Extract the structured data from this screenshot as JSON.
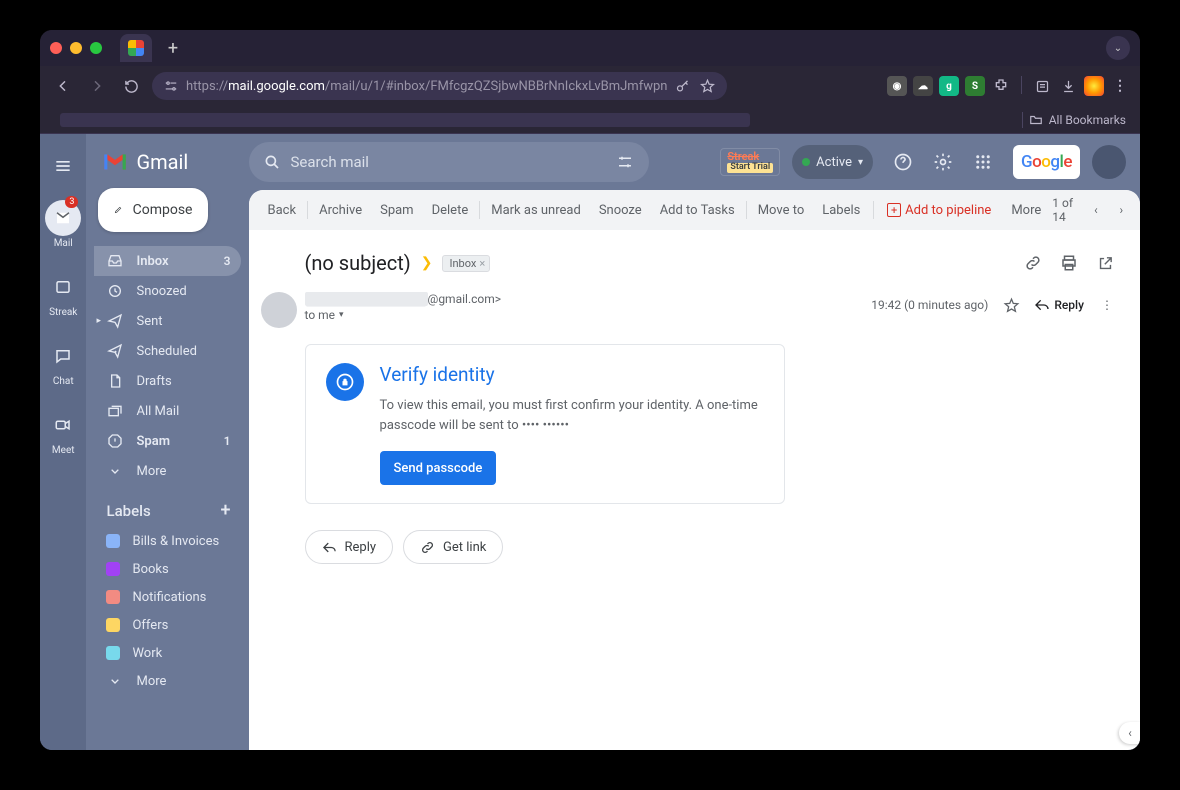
{
  "browser": {
    "url": "https://mail.google.com/mail/u/1/#inbox/FMfcgzQZSjbwNBBrNnIckxLvBmJmfwpn",
    "host": "mail.google.com",
    "path": "/mail/u/1/#inbox/FMfcgzQZSjbwNBBrNnIckxLvBmJmfwpn",
    "all_bookmarks": "All Bookmarks"
  },
  "rail": {
    "items": [
      {
        "label": "Mail",
        "badge": "3"
      },
      {
        "label": "Streak"
      },
      {
        "label": "Chat"
      },
      {
        "label": "Meet"
      }
    ]
  },
  "sidebar": {
    "brand": "Gmail",
    "compose": "Compose",
    "nav": [
      {
        "label": "Inbox",
        "count": "3",
        "selected": true,
        "bold": true
      },
      {
        "label": "Snoozed"
      },
      {
        "label": "Sent"
      },
      {
        "label": "Scheduled"
      },
      {
        "label": "Drafts"
      },
      {
        "label": "All Mail"
      },
      {
        "label": "Spam",
        "count": "1",
        "bold": true
      },
      {
        "label": "More"
      }
    ],
    "labels_header": "Labels",
    "labels": [
      {
        "label": "Bills & Invoices",
        "color": "#8ab4f8"
      },
      {
        "label": "Books",
        "color": "#a142f4"
      },
      {
        "label": "Notifications",
        "color": "#f28b82"
      },
      {
        "label": "Offers",
        "color": "#fdd663"
      },
      {
        "label": "Work",
        "color": "#78d9ec"
      },
      {
        "label": "More",
        "more": true
      }
    ]
  },
  "header": {
    "search_placeholder": "Search mail",
    "streak_top": "Streak",
    "streak_sub": "Start Trial",
    "active": "Active"
  },
  "toolbar": {
    "items": [
      "Back",
      "Archive",
      "Spam",
      "Delete",
      "Mark as unread",
      "Snooze",
      "Add to Tasks",
      "Move to",
      "Labels"
    ],
    "pipeline": "Add to pipeline",
    "more": "More",
    "pager": "1 of 14"
  },
  "mail": {
    "subject": "(no subject)",
    "inbox_chip": "Inbox",
    "from_suffix": "@gmail.com>",
    "to": "to me",
    "time": "19:42 (0 minutes ago)",
    "reply": "Reply",
    "card_title": "Verify identity",
    "card_body": "To view this email, you must first confirm your identity. A one-time passcode will be sent to •••• •••••• ",
    "send": "Send passcode",
    "reply_btn": "Reply",
    "getlink": "Get link"
  }
}
